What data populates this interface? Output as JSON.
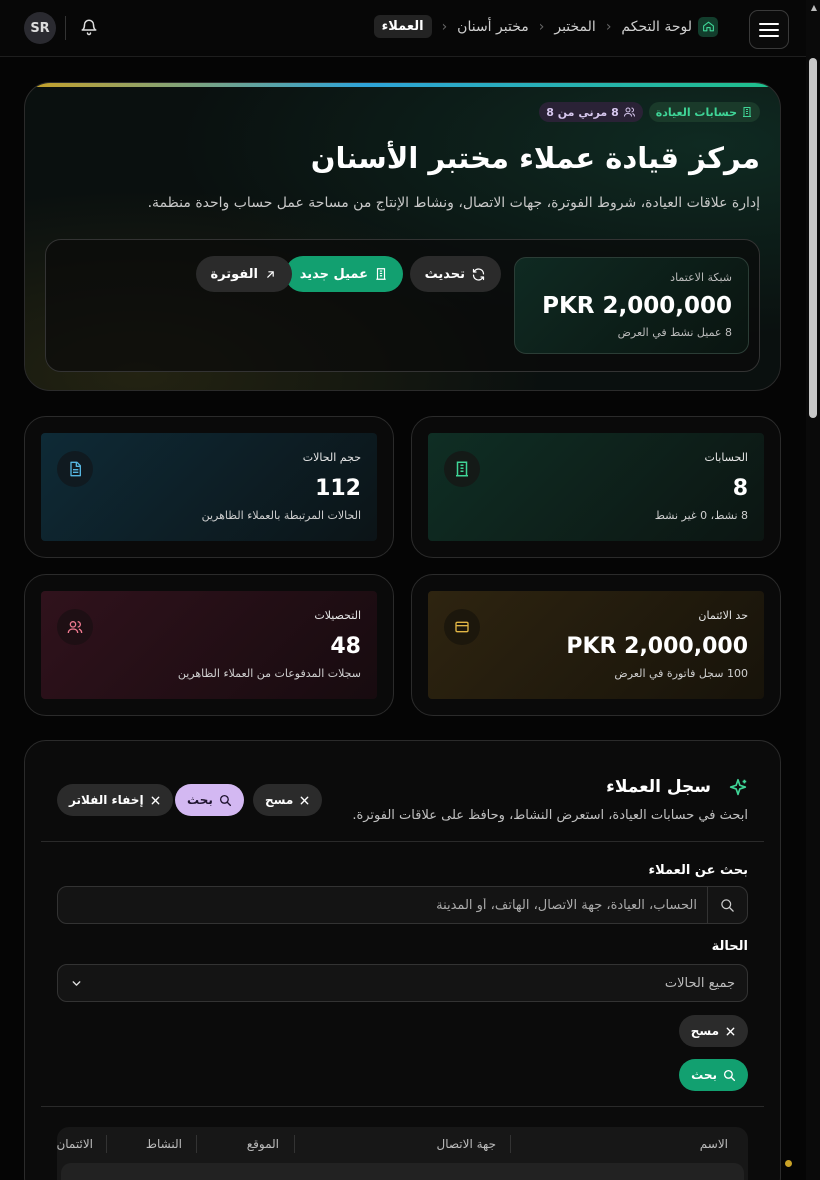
{
  "topbar": {
    "avatar": "SR",
    "breadcrumbs": [
      "لوحة التحكم",
      "المختبر",
      "مختبر أسنان",
      "العملاء"
    ]
  },
  "hero": {
    "chip_accounts": "حسابات العيادة",
    "chip_flexible": "8 مرني من 8",
    "title": "مركز قيادة عملاء مختبر الأسنان",
    "description": "إدارة علاقات العيادة، شروط الفوترة، جهات الاتصال، ونشاط الإنتاج من مساحة عمل حساب واحدة منظمة.",
    "credit_label": "شبكة الاعتماد",
    "credit_value": "PKR 2,000,000",
    "credit_sub": "8 عميل نشط في العرض",
    "btn_refresh": "تحديث",
    "btn_new_client": "عميل جديد",
    "btn_invoice": "الفوترة"
  },
  "stats": [
    {
      "label": "الحسابات",
      "value": "8",
      "sub": "8 نشط، 0 غير نشط",
      "icon": "building-icon"
    },
    {
      "label": "حجم الحالات",
      "value": "112",
      "sub": "الحالات المرتبطة بالعملاء الظاهرين",
      "icon": "document-icon"
    },
    {
      "label": "حد الائتمان",
      "value": "PKR 2,000,000",
      "sub": "100 سجل فاتورة في العرض",
      "icon": "card-icon"
    },
    {
      "label": "التحصيلات",
      "value": "48",
      "sub": "سجلات المدفوعات من العملاء الظاهرين",
      "icon": "users-icon"
    }
  ],
  "registry": {
    "title": "سجل العملاء",
    "description": "ابحث في حسابات العيادة، استعرض النشاط، وحافظ على علاقات الفوترة.",
    "btn_clear": "مسح",
    "btn_search": "بحث",
    "btn_hide_filters": "إخفاء الفلاتر",
    "search_label": "بحث عن العملاء",
    "search_placeholder": "الحساب، العيادة، جهة الاتصال، الهاتف، أو المدينة",
    "status_label": "الحالة",
    "status_value": "جميع الحالات",
    "table_headers": [
      "الاسم",
      "جهة الاتصال",
      "الموقع",
      "النشاط",
      "الائتمان"
    ]
  },
  "colors": {
    "accent_green": "#12a070",
    "accent_purple": "#d3b8f2",
    "background": "#050505"
  }
}
